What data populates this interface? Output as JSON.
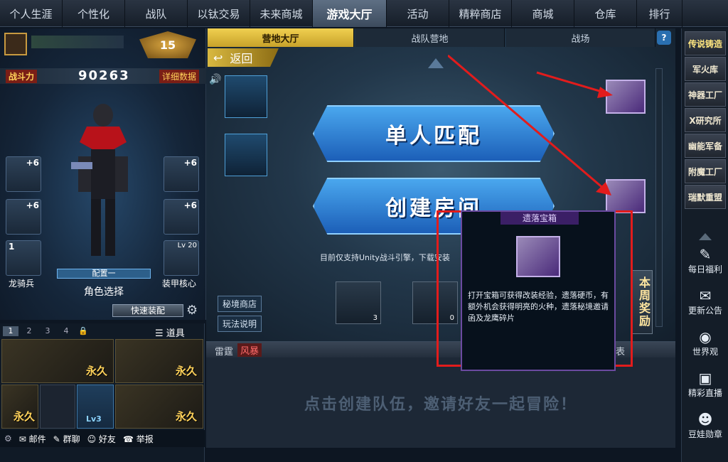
{
  "topnav": {
    "items": [
      "个人生涯",
      "个性化",
      "战队",
      "以钛交易",
      "未来商城",
      "游戏大厅",
      "活动",
      "精粹商店",
      "商城",
      "仓库",
      "排行"
    ],
    "active": "游戏大厅"
  },
  "player": {
    "level": "15",
    "combat_label": "战斗力",
    "combat_value": "90263",
    "detail_button": "详细数据",
    "equip_plus": [
      "+6",
      "+6",
      "+6",
      "+6"
    ],
    "slot_one_count": "1",
    "left_slot_label": "龙骑兵",
    "core_level": "Lv 20",
    "core_label": "装甲核心",
    "config_label": "配置一",
    "role_select": "角色选择",
    "quick_equip": "快速装配"
  },
  "inventory": {
    "tabs": [
      "1",
      "2",
      "3",
      "4"
    ],
    "props_label": "道具",
    "permanent": "永久",
    "lv3": "Lv3",
    "bottom_buttons": [
      "邮件",
      "群聊",
      "好友",
      "举报"
    ]
  },
  "center": {
    "tabs": [
      "营地大厅",
      "战队营地",
      "战场"
    ],
    "help_icon": "?",
    "back_button": "返回",
    "single_match": "单人匹配",
    "create_room": "创建房间",
    "notice": "目前仅支持Unity战斗引擎，下载安装",
    "secret_shop": "秘境商店",
    "gameplay_help": "玩法说明",
    "item_counts": [
      "3",
      "0"
    ],
    "weekly_reward": "本周奖励",
    "chat_tabs": [
      "雷霆",
      "风暴"
    ],
    "chat_tab_partial": "表",
    "chat_prompt": "点击创建队伍，邀请好友一起冒险！"
  },
  "tooltip": {
    "title": "遗落宝箱",
    "description": "打开宝箱可获得改装经验，遗落硬币，有额外机会获得明亮的火种，遗落秘境邀请函及龙鹰碎片"
  },
  "rightmenu": {
    "top_items": [
      "传说铸造",
      "军火库",
      "神器工厂",
      "X研究所",
      "幽能军备",
      "附魔工厂",
      "瑞默重盟"
    ],
    "bottom_items": [
      "每日福利",
      "更新公告",
      "世界观",
      "精彩直播",
      "豆娃勋章"
    ]
  },
  "colors": {
    "accent_gold": "#ffd25a",
    "active_tab": "#f0d050",
    "highlight_red": "#e21c1c",
    "purple_border": "#6b4aa0"
  }
}
